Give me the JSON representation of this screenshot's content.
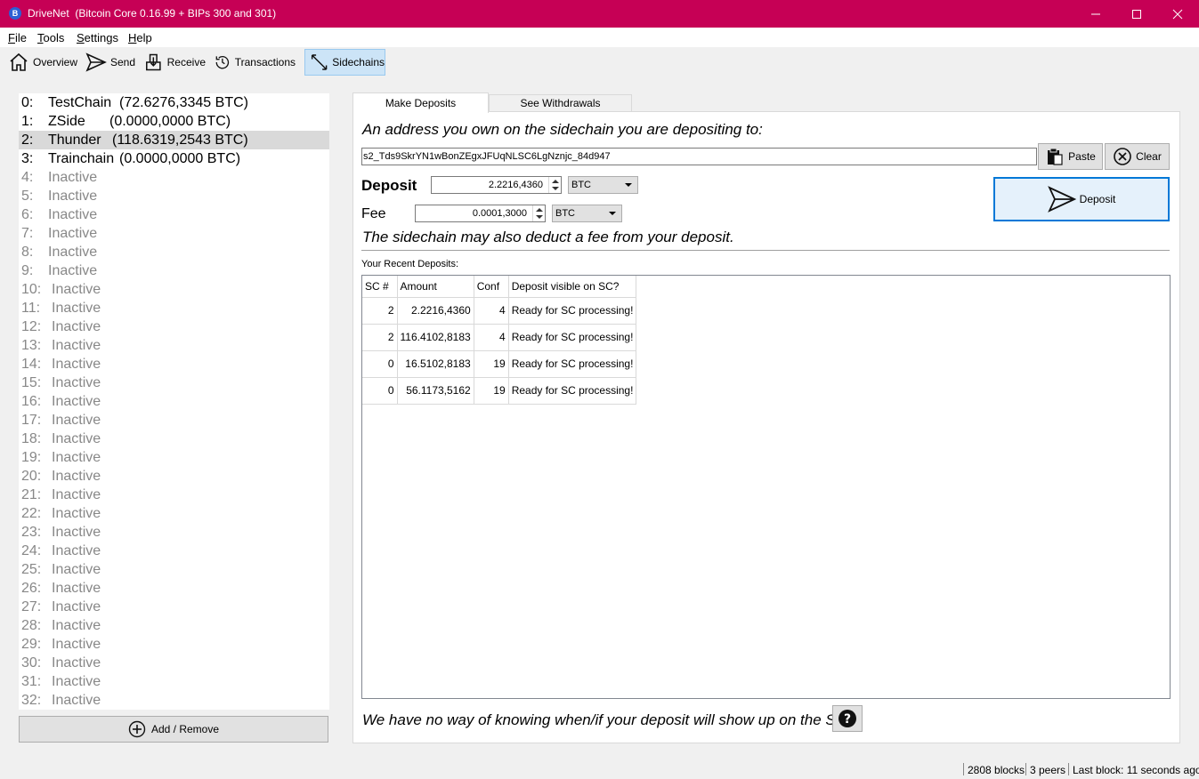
{
  "window": {
    "app_name": "DriveNet",
    "subtitle": "(Bitcoin Core 0.16.99 + BIPs 300 and 301)",
    "icon_letter": "B"
  },
  "menu": [
    {
      "label": "File",
      "mnemonic": "F",
      "rest": "ile"
    },
    {
      "label": "Tools",
      "mnemonic": "T",
      "rest": "ools"
    },
    {
      "label": "Settings",
      "mnemonic": "S",
      "rest": "ettings"
    },
    {
      "label": "Help",
      "mnemonic": "H",
      "rest": "elp"
    }
  ],
  "toolbar": {
    "overview": "Overview",
    "send": "Send",
    "receive": "Receive",
    "transactions": "Transactions",
    "sidechains": "Sidechains"
  },
  "sidechains": [
    {
      "index": "0:",
      "name": "TestChain",
      "balance": "(72.6276,3345 BTC)",
      "active": true
    },
    {
      "index": "1:",
      "name": "ZSide",
      "balance": "(0.0000,0000 BTC)",
      "active": true
    },
    {
      "index": "2:",
      "name": "Thunder",
      "balance": "(118.6319,2543 BTC)",
      "active": true,
      "selected": true
    },
    {
      "index": "3:",
      "name": "Trainchain",
      "balance": "(0.0000,0000 BTC)",
      "active": true
    },
    {
      "index": "4:",
      "name": "Inactive",
      "active": false
    },
    {
      "index": "5:",
      "name": "Inactive",
      "active": false
    },
    {
      "index": "6:",
      "name": "Inactive",
      "active": false
    },
    {
      "index": "7:",
      "name": "Inactive",
      "active": false
    },
    {
      "index": "8:",
      "name": "Inactive",
      "active": false
    },
    {
      "index": "9:",
      "name": "Inactive",
      "active": false
    },
    {
      "index": "10:",
      "name": "Inactive",
      "active": false
    },
    {
      "index": "11:",
      "name": "Inactive",
      "active": false
    },
    {
      "index": "12:",
      "name": "Inactive",
      "active": false
    },
    {
      "index": "13:",
      "name": "Inactive",
      "active": false
    },
    {
      "index": "14:",
      "name": "Inactive",
      "active": false
    },
    {
      "index": "15:",
      "name": "Inactive",
      "active": false
    },
    {
      "index": "16:",
      "name": "Inactive",
      "active": false
    },
    {
      "index": "17:",
      "name": "Inactive",
      "active": false
    },
    {
      "index": "18:",
      "name": "Inactive",
      "active": false
    },
    {
      "index": "19:",
      "name": "Inactive",
      "active": false
    },
    {
      "index": "20:",
      "name": "Inactive",
      "active": false
    },
    {
      "index": "21:",
      "name": "Inactive",
      "active": false
    },
    {
      "index": "22:",
      "name": "Inactive",
      "active": false
    },
    {
      "index": "23:",
      "name": "Inactive",
      "active": false
    },
    {
      "index": "24:",
      "name": "Inactive",
      "active": false
    },
    {
      "index": "25:",
      "name": "Inactive",
      "active": false
    },
    {
      "index": "26:",
      "name": "Inactive",
      "active": false
    },
    {
      "index": "27:",
      "name": "Inactive",
      "active": false
    },
    {
      "index": "28:",
      "name": "Inactive",
      "active": false
    },
    {
      "index": "29:",
      "name": "Inactive",
      "active": false
    },
    {
      "index": "30:",
      "name": "Inactive",
      "active": false
    },
    {
      "index": "31:",
      "name": "Inactive",
      "active": false
    },
    {
      "index": "32:",
      "name": "Inactive",
      "active": false
    }
  ],
  "add_remove_label": "Add / Remove",
  "tabs": {
    "make_deposits": "Make Deposits",
    "see_withdrawals": "See Withdrawals"
  },
  "deposit_form": {
    "address_prompt": "An address you own on the sidechain you are depositing to:",
    "address_value": "s2_Tds9SkrYN1wBonZEgxJFUqNLSC6LgNznjc_84d947",
    "paste_label": "Paste",
    "clear_label": "Clear",
    "deposit_label": "Deposit",
    "deposit_amount": "2.2216,4360",
    "deposit_unit": "BTC",
    "fee_label": "Fee",
    "fee_amount": "0.0001,3000",
    "fee_unit": "BTC",
    "deposit_button": "Deposit",
    "fee_note": "The sidechain may also deduct a fee from your deposit.",
    "recent_label": "Your Recent Deposits:"
  },
  "recent_deposits": {
    "headers": [
      "SC #",
      "Amount",
      "Conf",
      "Deposit visible on SC?"
    ],
    "rows": [
      [
        "2",
        "2.2216,4360",
        "4",
        "Ready for SC processing!"
      ],
      [
        "2",
        "116.4102,8183",
        "4",
        "Ready for SC processing!"
      ],
      [
        "0",
        "16.5102,8183",
        "19",
        "Ready for SC processing!"
      ],
      [
        "0",
        "56.1173,5162",
        "19",
        "Ready for SC processing!"
      ]
    ]
  },
  "footer_note": "We have no way of knowing when/if your deposit will show up on the SC",
  "status": {
    "blocks": "2808 blocks",
    "peers": "3 peers",
    "last_block": "Last block: 11 seconds ago"
  },
  "colors": {
    "titlebar": "#c60055",
    "accent": "#0078d7"
  }
}
